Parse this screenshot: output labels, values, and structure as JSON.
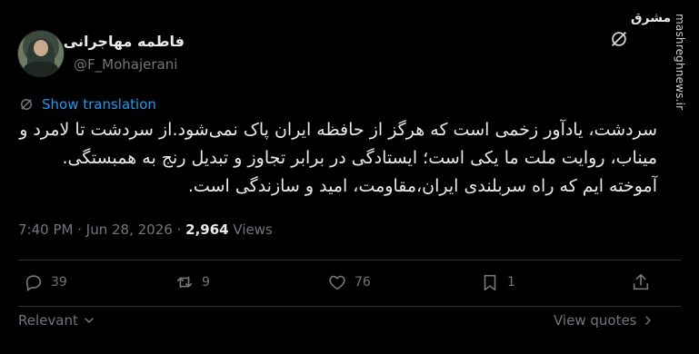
{
  "tweet": {
    "author_name": "فاطمه مهاجرانی",
    "author_handle": "@F_Mohajerani",
    "show_translation": "Show translation",
    "body": "سردشت، یادآور زخمی است که هرگز از حافظه ایران پاک نمی‌شود.از سردشت تا لامرد و میناب، روایت ملت ما یکی است؛ ایستادگی در برابر تجاوز و تبدیل رنج به همبستگی. آموخته ایم که راه سربلندی  ایران،مقاومت، امید و سازندگی است.",
    "time": "7:40 PM",
    "separator": "·",
    "date": "Jun 28, 2026",
    "views_count": "2,964",
    "views_label": "Views"
  },
  "actions": {
    "replies": "39",
    "reposts": "9",
    "likes": "76",
    "bookmarks": "1"
  },
  "footer": {
    "sort_label": "Relevant",
    "view_quotes": "View quotes"
  },
  "watermark": {
    "brand": "مشرق",
    "site": "mashreghnews.ir"
  },
  "icons": [
    "translate-icon",
    "reply-icon",
    "repost-icon",
    "like-icon",
    "bookmark-icon",
    "share-icon",
    "chevron-down-icon",
    "chevron-right-icon",
    "brand-logo-icon"
  ]
}
